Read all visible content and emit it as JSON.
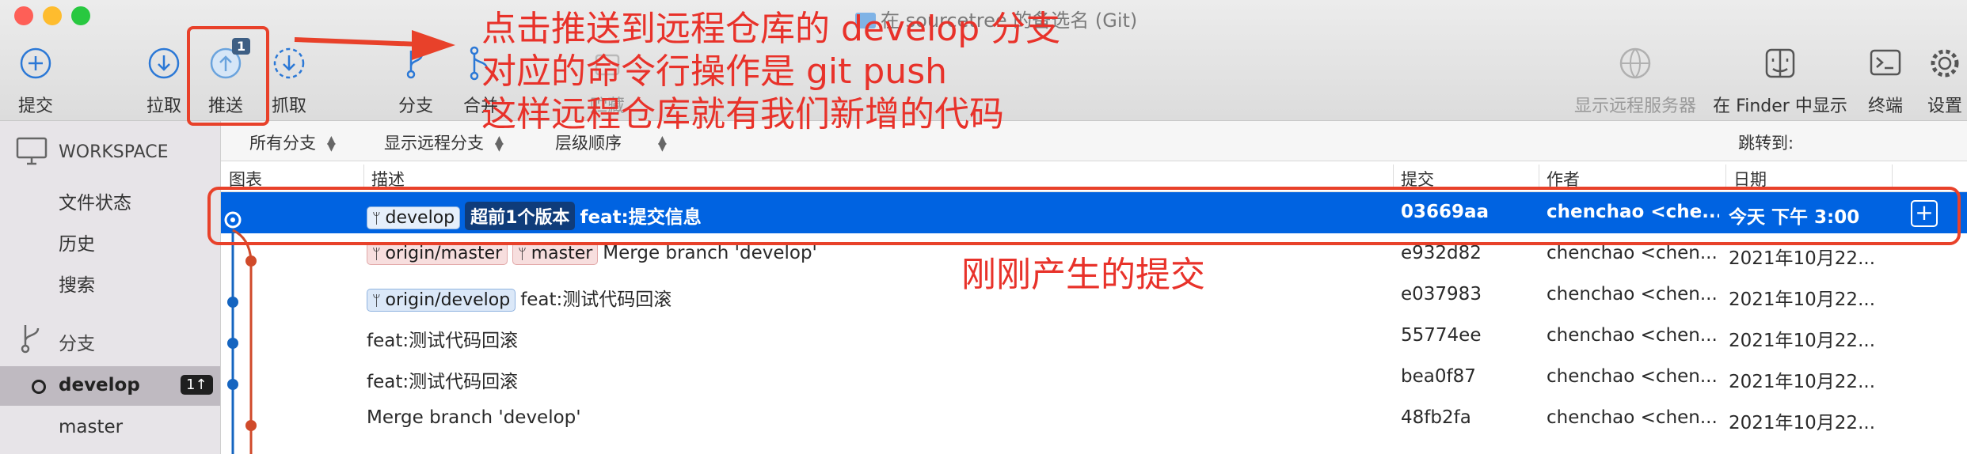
{
  "window": {
    "title": "在 sourcetree 的备选名 (Git)"
  },
  "colors": {
    "accent": "#0063e1",
    "annotation": "#e8322a",
    "local_branch": "#1565c0",
    "remote_branch": "#d04a2a"
  },
  "toolbar": {
    "commit": "提交",
    "pull": "拉取",
    "push": "推送",
    "push_badge": "1",
    "fetch": "抓取",
    "branch": "分支",
    "merge": "合并",
    "stash": "贮藏",
    "show_remote": "显示远程服务器",
    "show_in_finder": "在 Finder 中显示",
    "terminal": "终端",
    "settings": "设置"
  },
  "sidebar": {
    "workspace": "WORKSPACE",
    "file_status": "文件状态",
    "history": "历史",
    "search": "搜索",
    "branches": "分支",
    "develop": "develop",
    "develop_badge": "1↑",
    "master": "master"
  },
  "filters": {
    "all_branches": "所有分支",
    "show_remote_branches": "显示远程分支",
    "order": "层级顺序",
    "jump_to": "跳转到:"
  },
  "columns": {
    "graph": "图表",
    "description": "描述",
    "commit": "提交",
    "author": "作者",
    "date": "日期"
  },
  "commits": [
    {
      "tags": [
        {
          "name": "develop",
          "kind": "local"
        },
        {
          "name": "超前1个版本",
          "kind": "ahead"
        }
      ],
      "message": "feat:提交信息",
      "hash": "03669aa",
      "author": "chenchao <che...",
      "date": "今天 下午 3:00"
    },
    {
      "tags": [
        {
          "name": "origin/master",
          "kind": "remote"
        },
        {
          "name": "master",
          "kind": "remote"
        }
      ],
      "message": "Merge branch 'develop'",
      "hash": "e932d82",
      "author": "chenchao <chen...",
      "date": "2021年10月22..."
    },
    {
      "tags": [
        {
          "name": "origin/develop",
          "kind": "local"
        }
      ],
      "message": "feat:测试代码回滚",
      "hash": "e037983",
      "author": "chenchao <chen...",
      "date": "2021年10月22..."
    },
    {
      "tags": [],
      "message": "feat:测试代码回滚",
      "hash": "55774ee",
      "author": "chenchao <chen...",
      "date": "2021年10月22..."
    },
    {
      "tags": [],
      "message": "feat:测试代码回滚",
      "hash": "bea0f87",
      "author": "chenchao <chen...",
      "date": "2021年10月22..."
    },
    {
      "tags": [],
      "message": "Merge branch 'develop'",
      "hash": "48fb2fa",
      "author": "chenchao <chen...",
      "date": "2021年10月22..."
    }
  ],
  "annotations": {
    "line1": "点击推送到远程仓库的 develop 分支",
    "line2": "对应的命令行操作是 git push",
    "line3": "这样远程仓库就有我们新增的代码",
    "new_commit": "刚刚产生的提交"
  }
}
